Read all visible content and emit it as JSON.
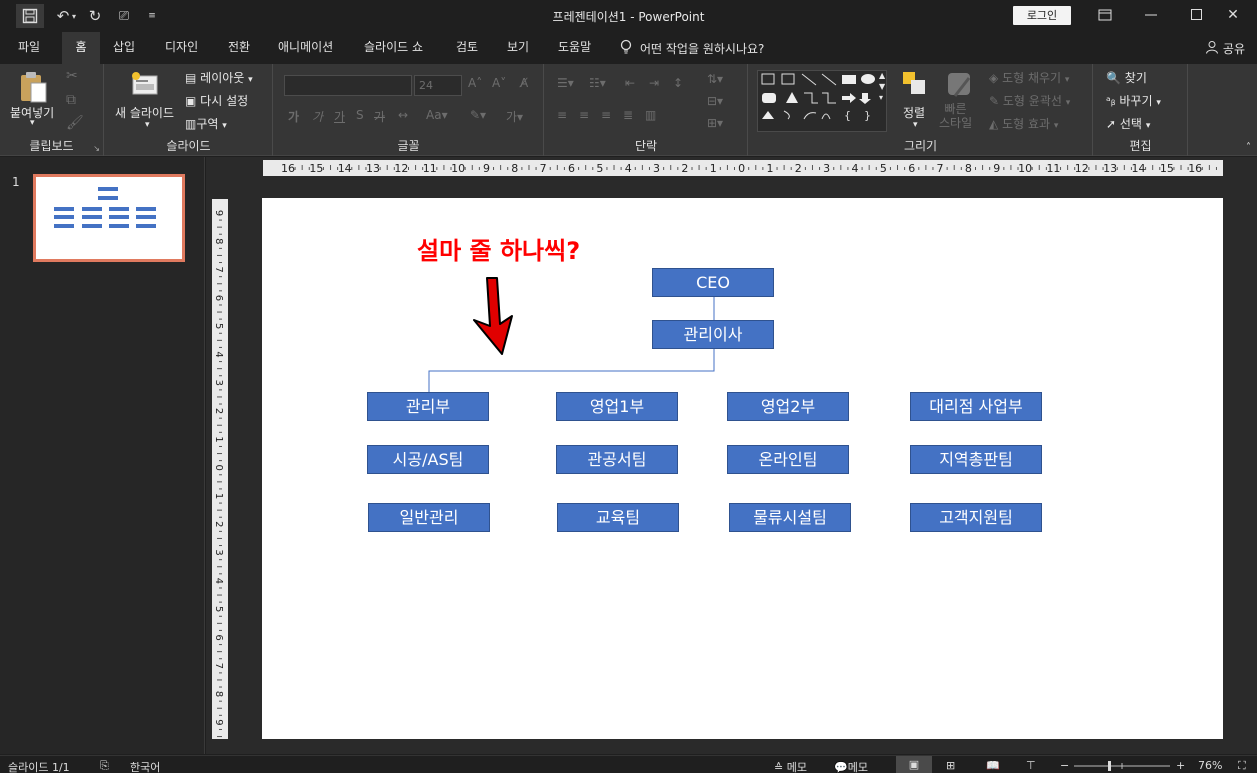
{
  "window": {
    "title": "프레젠테이션1 - PowerPoint",
    "login": "로그인",
    "qa_icons": [
      "save-icon",
      "undo-icon",
      "redo-icon",
      "present-icon",
      "customize-icon"
    ],
    "controls": [
      "restore-ribbon-icon",
      "minimize-icon",
      "maximize-icon",
      "close-icon"
    ]
  },
  "tabs": [
    "파일",
    "홈",
    "삽입",
    "디자인",
    "전환",
    "애니메이션",
    "슬라이드 쇼",
    "검토",
    "보기",
    "도움말"
  ],
  "active_tab": "홈",
  "tellme": "어떤 작업을 원하시나요?",
  "share": "공유",
  "ribbon": {
    "clipboard": {
      "label": "클립보드",
      "paste": "붙여넣기"
    },
    "slides": {
      "label": "슬라이드",
      "new_slide": "새 슬라이드",
      "layout": "레이아웃",
      "reset": "다시 설정",
      "section": "구역"
    },
    "font": {
      "label": "글꼴",
      "size": "24"
    },
    "paragraph": {
      "label": "단락"
    },
    "drawing": {
      "label": "그리기",
      "arrange": "정렬",
      "quick_styles": "빠른\n스타일",
      "fill": "도형 채우기",
      "outline": "도형 윤곽선",
      "effects": "도형 효과"
    },
    "editing": {
      "label": "편집",
      "find": "찾기",
      "replace": "바꾸기",
      "select": "선택"
    }
  },
  "slide_panel": {
    "number": "1"
  },
  "ruler": {
    "h": [
      "16",
      "15",
      "14",
      "13",
      "12",
      "11",
      "10",
      "9",
      "8",
      "7",
      "6",
      "5",
      "4",
      "3",
      "2",
      "1",
      "0",
      "1",
      "2",
      "3",
      "4",
      "5",
      "6",
      "7",
      "8",
      "9",
      "10",
      "11",
      "12",
      "13",
      "14",
      "15",
      "16"
    ],
    "v": [
      "9",
      "8",
      "7",
      "6",
      "5",
      "4",
      "3",
      "2",
      "1",
      "0",
      "1",
      "2",
      "3",
      "4",
      "5",
      "6",
      "7",
      "8",
      "9"
    ]
  },
  "slide": {
    "annotation": "설마 줄 하나씩?",
    "boxes": {
      "ceo": "CEO",
      "director": "관리이사",
      "mgmt": "관리부",
      "sales1": "영업1부",
      "sales2": "영업2부",
      "agency": "대리점 사업부",
      "construction": "시공/AS팀",
      "public": "관공서팀",
      "online": "온라인팀",
      "regional": "지역총판팀",
      "general": "일반관리",
      "education": "교육팀",
      "logistics": "물류시설팀",
      "support": "고객지원팀"
    }
  },
  "status": {
    "slide": "슬라이드 1/1",
    "lang": "한국어",
    "notes": "메모",
    "comments": "메모",
    "zoom": "76%"
  }
}
